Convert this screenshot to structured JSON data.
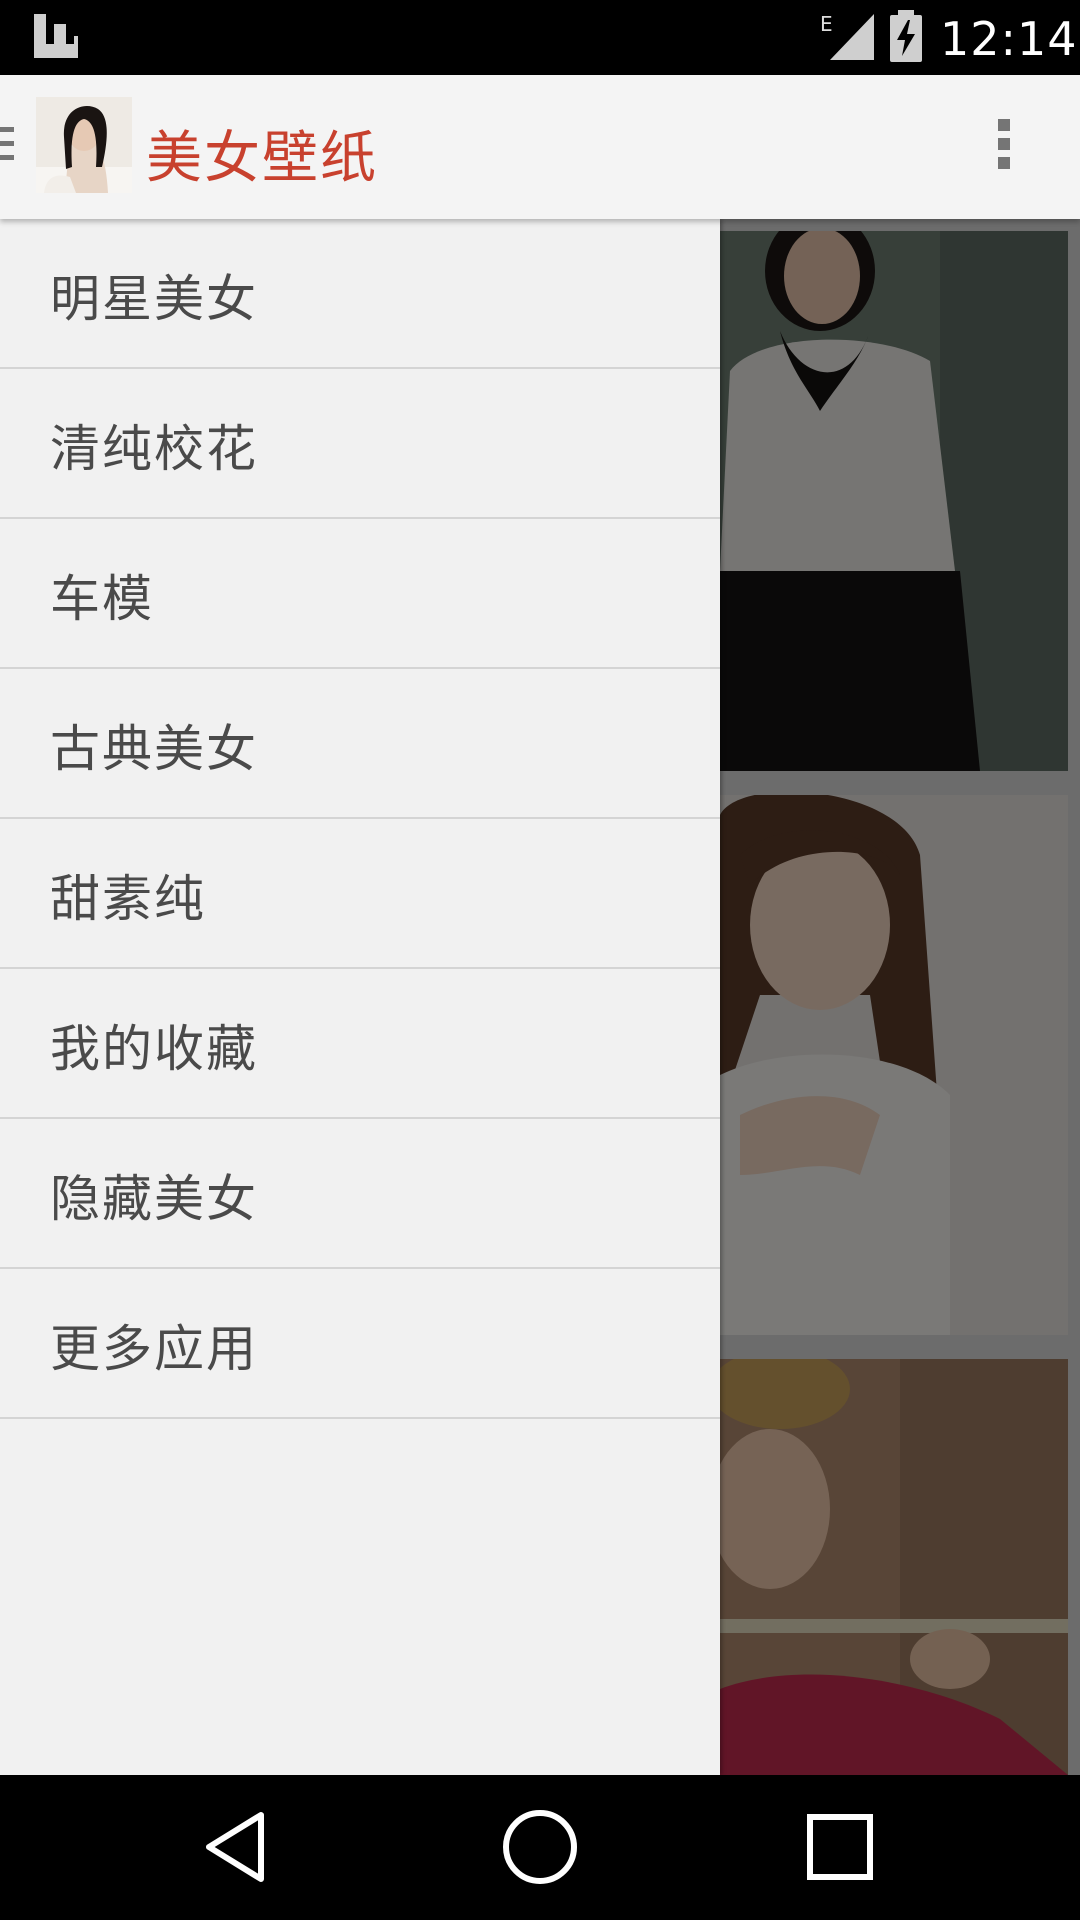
{
  "status_bar": {
    "network_type": "E",
    "time": "12:14"
  },
  "toolbar": {
    "title": "美女壁纸",
    "title_color": "#c8412e"
  },
  "drawer": {
    "items": [
      {
        "label": "明星美女"
      },
      {
        "label": "清纯校花"
      },
      {
        "label": "车模"
      },
      {
        "label": "古典美女"
      },
      {
        "label": "甜素纯"
      },
      {
        "label": "我的收藏"
      },
      {
        "label": "隐藏美女"
      },
      {
        "label": "更多应用"
      }
    ]
  },
  "icons": {
    "menu": "hamburger-icon",
    "overflow": "overflow-menu-icon",
    "back": "back-icon",
    "home": "home-icon",
    "recents": "recents-icon",
    "notification": "launcher-notification-icon",
    "signal": "signal-icon",
    "battery": "battery-charging-icon"
  }
}
